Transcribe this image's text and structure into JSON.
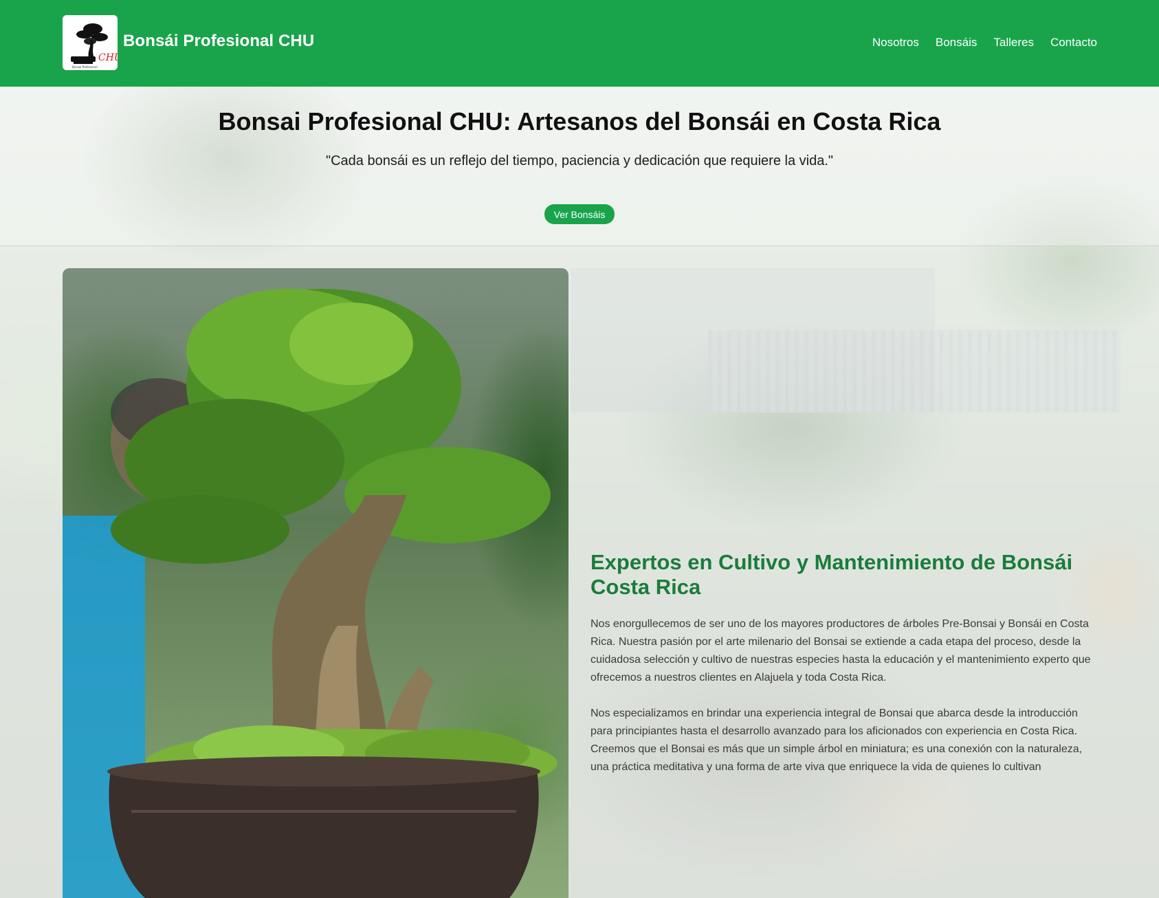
{
  "header": {
    "brand": "Bonsái Profesional CHU",
    "logo_icon": "bonsai-logo-icon",
    "logo_text": "CHU",
    "logo_subtext": "Bonsai Profesional",
    "background_color": "#19a44c",
    "nav": [
      {
        "label": "Nosotros"
      },
      {
        "label": "Bonsáis"
      },
      {
        "label": "Talleres"
      },
      {
        "label": "Contacto"
      }
    ]
  },
  "hero": {
    "title": "Bonsai Profesional CHU: Artesanos del Bonsái en Costa Rica",
    "quote": "\"Cada bonsái es un reflejo del tiempo, paciencia y dedicación que requiere la vida.\"",
    "button_label": "Ver Bonsáis"
  },
  "about": {
    "image_icon": "bonsai-photo",
    "heading": "Expertos en Cultivo y Mantenimiento de Bonsái Costa Rica",
    "heading_color": "#1b7b3d",
    "paragraphs": [
      "Nos enorgullecemos de ser uno de los mayores productores de árboles Pre-Bonsai y Bonsái en Costa Rica. Nuestra pasión por el arte milenario del Bonsai se extiende a cada etapa del proceso, desde la cuidadosa selección y cultivo de nuestras especies hasta la educación y el mantenimiento experto que ofrecemos a nuestros clientes en Alajuela y toda Costa Rica.",
      "Nos especializamos en brindar una experiencia integral de Bonsai que abarca desde la introducción para principiantes hasta el desarrollo avanzado para los aficionados con experiencia en Costa Rica. Creemos que el Bonsai es más que un simple árbol en miniatura; es una conexión con la naturaleza, una práctica meditativa y una forma de arte viva que enriquece la vida de quienes lo cultivan"
    ]
  }
}
